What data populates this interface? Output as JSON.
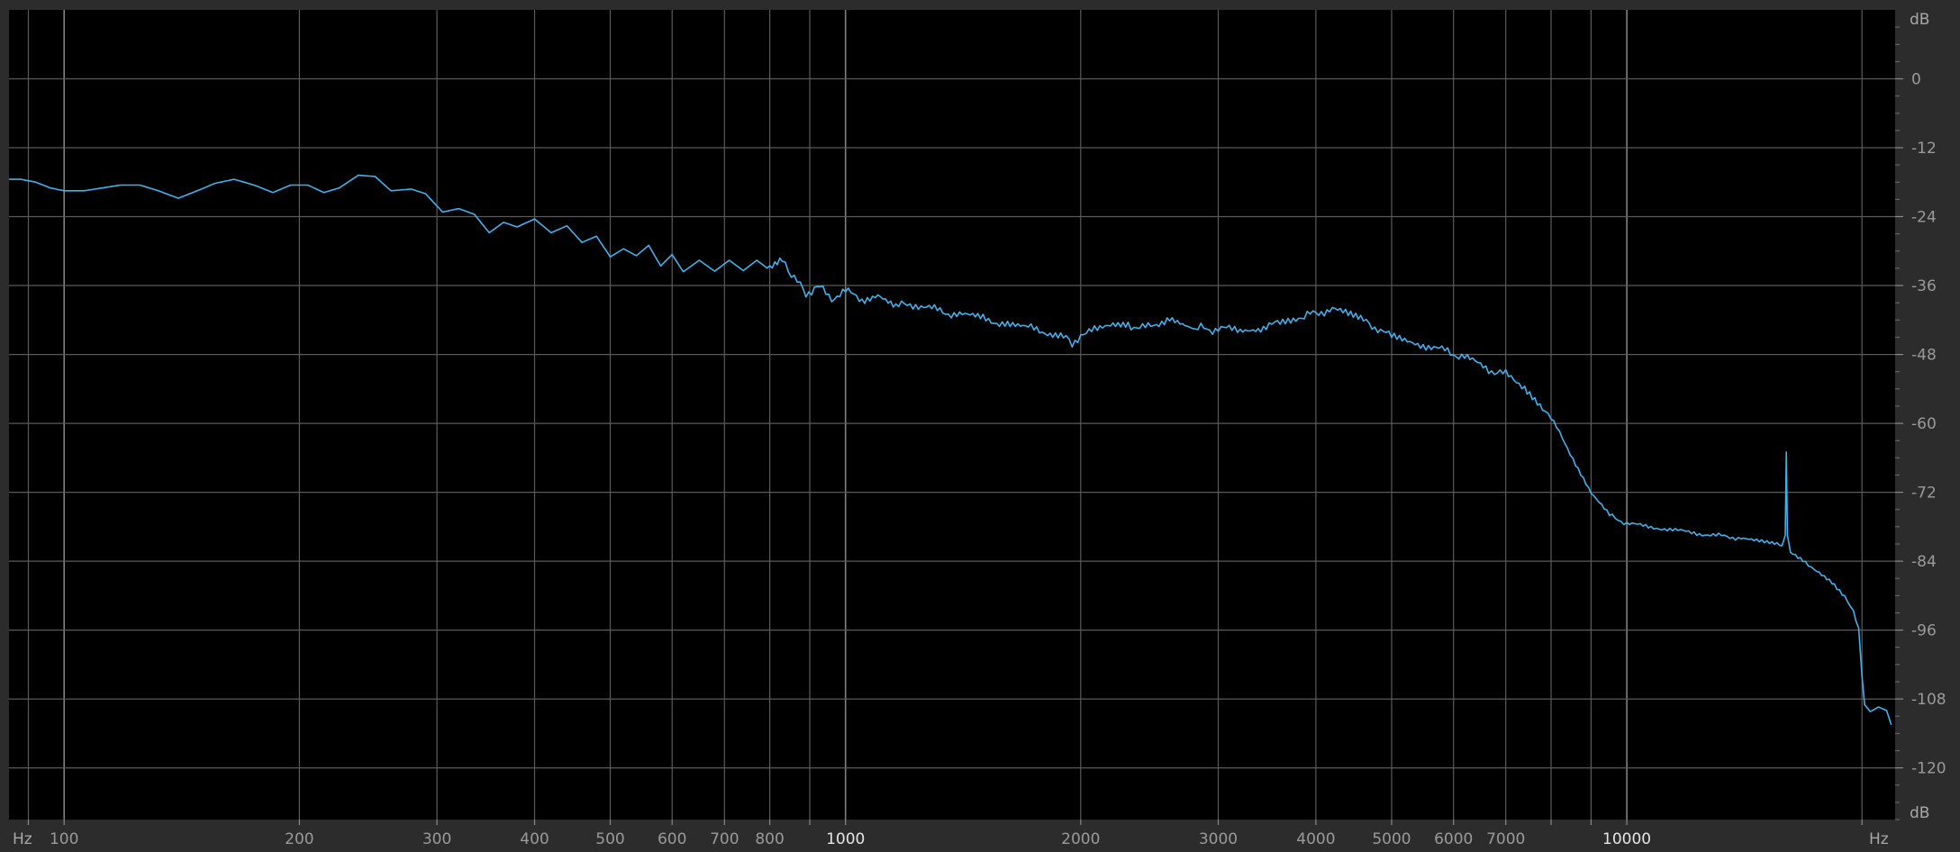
{
  "chart_data": {
    "type": "line",
    "x_scale": "log",
    "xlim": [
      85,
      22050
    ],
    "ylim": [
      -129,
      12
    ],
    "x_unit_label": "Hz",
    "y_unit_label": "dB",
    "x_tick_labels": [
      {
        "value": 100,
        "label": "100",
        "major": false
      },
      {
        "value": 200,
        "label": "200",
        "major": false
      },
      {
        "value": 300,
        "label": "300",
        "major": false
      },
      {
        "value": 400,
        "label": "400",
        "major": false
      },
      {
        "value": 500,
        "label": "500",
        "major": false
      },
      {
        "value": 600,
        "label": "600",
        "major": false
      },
      {
        "value": 700,
        "label": "700",
        "major": false
      },
      {
        "value": 800,
        "label": "800",
        "major": false
      },
      {
        "value": 1000,
        "label": "1000",
        "major": true
      },
      {
        "value": 2000,
        "label": "2000",
        "major": false
      },
      {
        "value": 3000,
        "label": "3000",
        "major": false
      },
      {
        "value": 4000,
        "label": "4000",
        "major": false
      },
      {
        "value": 5000,
        "label": "5000",
        "major": false
      },
      {
        "value": 6000,
        "label": "6000",
        "major": false
      },
      {
        "value": 7000,
        "label": "7000",
        "major": false
      },
      {
        "value": 10000,
        "label": "10000",
        "major": true
      }
    ],
    "x_gridlines": [
      90,
      100,
      200,
      300,
      400,
      500,
      600,
      700,
      800,
      900,
      1000,
      2000,
      3000,
      4000,
      5000,
      6000,
      7000,
      8000,
      9000,
      10000,
      20000
    ],
    "y_ticks": [
      0,
      -12,
      -24,
      -36,
      -48,
      -60,
      -72,
      -84,
      -96,
      -108,
      -120
    ],
    "y_tick_labels": [
      "0",
      "-12",
      "-24",
      "-36",
      "-48",
      "-60",
      "-72",
      "-84",
      "-96",
      "-108",
      "-120"
    ],
    "grid": true,
    "series": [
      {
        "color": "#3fb2ee",
        "points": [
          [
            85,
            -17.5
          ],
          [
            88,
            -17.5
          ],
          [
            92,
            -18
          ],
          [
            96,
            -19
          ],
          [
            100,
            -19.5
          ],
          [
            106,
            -19.5
          ],
          [
            112,
            -19
          ],
          [
            118,
            -18.5
          ],
          [
            125,
            -18.5
          ],
          [
            132,
            -19.5
          ],
          [
            140,
            -20.8
          ],
          [
            148,
            -19.5
          ],
          [
            156,
            -18.2
          ],
          [
            165,
            -17.5
          ],
          [
            175,
            -18.5
          ],
          [
            185,
            -19.8
          ],
          [
            195,
            -18.5
          ],
          [
            205,
            -18.5
          ],
          [
            215,
            -19.8
          ],
          [
            225,
            -19
          ],
          [
            238,
            -16.8
          ],
          [
            250,
            -17
          ],
          [
            262,
            -19.5
          ],
          [
            278,
            -19.2
          ],
          [
            290,
            -20
          ],
          [
            305,
            -23.2
          ],
          [
            320,
            -22.6
          ],
          [
            335,
            -23.6
          ],
          [
            350,
            -26.8
          ],
          [
            365,
            -25
          ],
          [
            380,
            -25.8
          ],
          [
            400,
            -24.4
          ],
          [
            420,
            -26.8
          ],
          [
            440,
            -25.6
          ],
          [
            460,
            -28.5
          ],
          [
            480,
            -27.4
          ],
          [
            500,
            -31
          ],
          [
            520,
            -29.6
          ],
          [
            540,
            -30.8
          ],
          [
            560,
            -29
          ],
          [
            580,
            -32.6
          ],
          [
            600,
            -30.6
          ],
          [
            620,
            -33.6
          ],
          [
            650,
            -31.6
          ],
          [
            680,
            -33.5
          ],
          [
            710,
            -31.6
          ],
          [
            740,
            -33.4
          ],
          [
            770,
            -31.6
          ],
          [
            800,
            -33.3
          ],
          [
            830,
            -31.8
          ],
          [
            860,
            -34.6
          ],
          [
            890,
            -37.5
          ],
          [
            920,
            -36
          ],
          [
            960,
            -38.2
          ],
          [
            1000,
            -37
          ],
          [
            1050,
            -38.4
          ],
          [
            1100,
            -37.4
          ],
          [
            1160,
            -39.6
          ],
          [
            1220,
            -39.2
          ],
          [
            1300,
            -40.2
          ],
          [
            1400,
            -41.2
          ],
          [
            1500,
            -41.8
          ],
          [
            1600,
            -42.6
          ],
          [
            1700,
            -43.3
          ],
          [
            1800,
            -44
          ],
          [
            1900,
            -44.6
          ],
          [
            1950,
            -46.5
          ],
          [
            2000,
            -44.4
          ],
          [
            2100,
            -43.8
          ],
          [
            2200,
            -42.6
          ],
          [
            2300,
            -42.8
          ],
          [
            2400,
            -43.5
          ],
          [
            2500,
            -42.6
          ],
          [
            2600,
            -41.5
          ],
          [
            2700,
            -42.6
          ],
          [
            2800,
            -43.2
          ],
          [
            2900,
            -43.6
          ],
          [
            3000,
            -43.7
          ],
          [
            3200,
            -43.5
          ],
          [
            3400,
            -43.3
          ],
          [
            3600,
            -42.6
          ],
          [
            3800,
            -41.5
          ],
          [
            4000,
            -40.8
          ],
          [
            4200,
            -40
          ],
          [
            4400,
            -41.2
          ],
          [
            4600,
            -42.2
          ],
          [
            4800,
            -43.5
          ],
          [
            5000,
            -45
          ],
          [
            5400,
            -46
          ],
          [
            5800,
            -47.2
          ],
          [
            6200,
            -48.5
          ],
          [
            6600,
            -50.5
          ],
          [
            7000,
            -51.5
          ],
          [
            7400,
            -53.5
          ],
          [
            7800,
            -57
          ],
          [
            8200,
            -61.5
          ],
          [
            8600,
            -67
          ],
          [
            9000,
            -72
          ],
          [
            9500,
            -76
          ],
          [
            10000,
            -77.5
          ],
          [
            11000,
            -78.2
          ],
          [
            12000,
            -79
          ],
          [
            13000,
            -79.5
          ],
          [
            14000,
            -80
          ],
          [
            15000,
            -80.8
          ],
          [
            15800,
            -81.3
          ],
          [
            15950,
            -79.5
          ],
          [
            16000,
            -65
          ],
          [
            16050,
            -79.5
          ],
          [
            16200,
            -82.5
          ],
          [
            16800,
            -84
          ],
          [
            17500,
            -85.5
          ],
          [
            18300,
            -87.5
          ],
          [
            19000,
            -90
          ],
          [
            19500,
            -93
          ],
          [
            19800,
            -96
          ],
          [
            20000,
            -104
          ],
          [
            20150,
            -109
          ],
          [
            20500,
            -110.2
          ],
          [
            21000,
            -109.4
          ],
          [
            21500,
            -110
          ],
          [
            21800,
            -112.5
          ]
        ]
      }
    ]
  }
}
